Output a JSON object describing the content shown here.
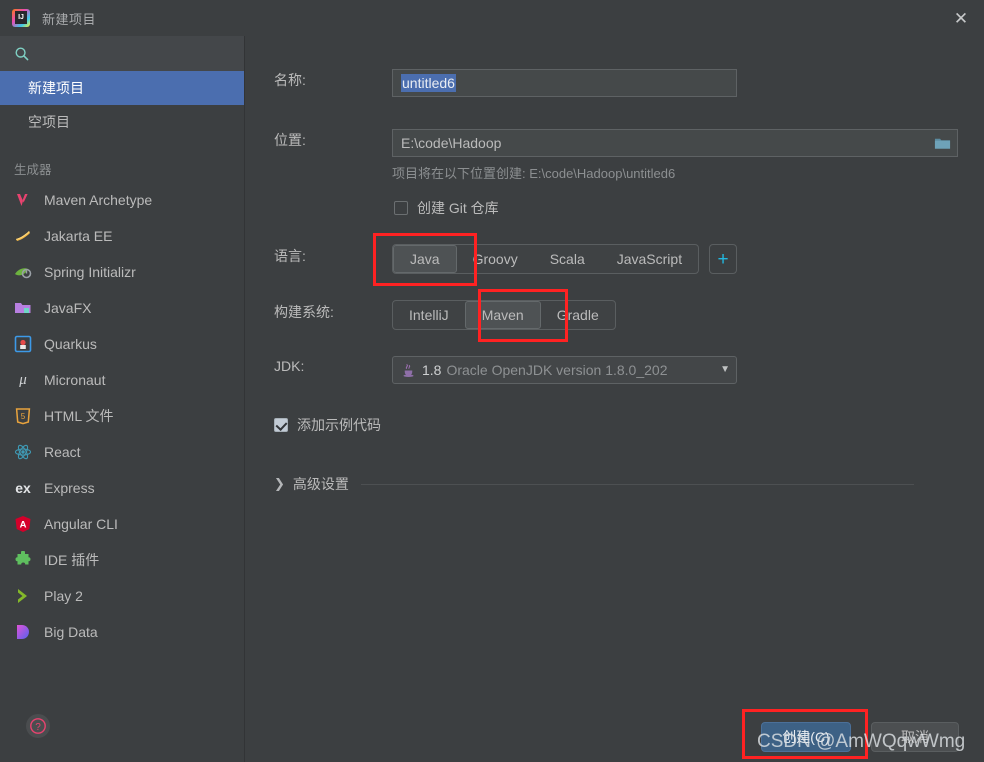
{
  "window": {
    "title": "新建项目",
    "app_icon": "intellij-idea-icon",
    "close_label": "✕"
  },
  "sidebar": {
    "search": {
      "placeholder": "",
      "value": "",
      "icon": "search-icon"
    },
    "templates": [
      {
        "label": "新建项目",
        "selected": true
      },
      {
        "label": "空项目",
        "selected": false
      }
    ],
    "group_title": "生成器",
    "generators": [
      {
        "label": "Maven Archetype",
        "icon": "maven-icon"
      },
      {
        "label": "Jakarta EE",
        "icon": "jakarta-ee-icon"
      },
      {
        "label": "Spring Initializr",
        "icon": "spring-icon"
      },
      {
        "label": "JavaFX",
        "icon": "javafx-icon"
      },
      {
        "label": "Quarkus",
        "icon": "quarkus-icon"
      },
      {
        "label": "Micronaut",
        "icon": "micronaut-icon"
      },
      {
        "label": "HTML 文件",
        "icon": "html5-icon"
      },
      {
        "label": "React",
        "icon": "react-icon"
      },
      {
        "label": "Express",
        "icon": "express-icon"
      },
      {
        "label": "Angular CLI",
        "icon": "angular-icon"
      },
      {
        "label": "IDE 插件",
        "icon": "plugin-icon"
      },
      {
        "label": "Play 2",
        "icon": "play2-icon"
      },
      {
        "label": "Big Data",
        "icon": "bigdata-icon"
      }
    ]
  },
  "form": {
    "name_label": "名称:",
    "name_value": "untitled6",
    "location_label": "位置:",
    "location_value": "E:\\code\\Hadoop",
    "browse_icon": "folder-icon",
    "location_hint": "项目将在以下位置创建: E:\\code\\Hadoop\\untitled6",
    "git_checkbox_label": "创建 Git 仓库",
    "git_checkbox_checked": false,
    "language_label": "语言:",
    "languages": [
      "Java",
      "Groovy",
      "Scala",
      "JavaScript"
    ],
    "language_selected": "Java",
    "add_language_label": "+",
    "build_system_label": "构建系统:",
    "build_systems": [
      "IntelliJ",
      "Maven",
      "Gradle"
    ],
    "build_system_selected": "Maven",
    "jdk_label": "JDK:",
    "jdk_version": "1.8",
    "jdk_description": "Oracle OpenJDK version 1.8.0_202",
    "sample_code_label": "添加示例代码",
    "sample_code_checked": true,
    "advanced_label": "高级设置"
  },
  "footer": {
    "help_label": "?",
    "create_label": "创建(C)",
    "cancel_label": "取消"
  },
  "watermark": {
    "text": "CSDN @AmWQqwWmg"
  },
  "colors": {
    "background": "#3c3f41",
    "selection_blue": "#4b6eaf",
    "accent_cyan": "#22b8e0",
    "annotation_red": "#ff2222",
    "primary_button": "#3d6185"
  }
}
